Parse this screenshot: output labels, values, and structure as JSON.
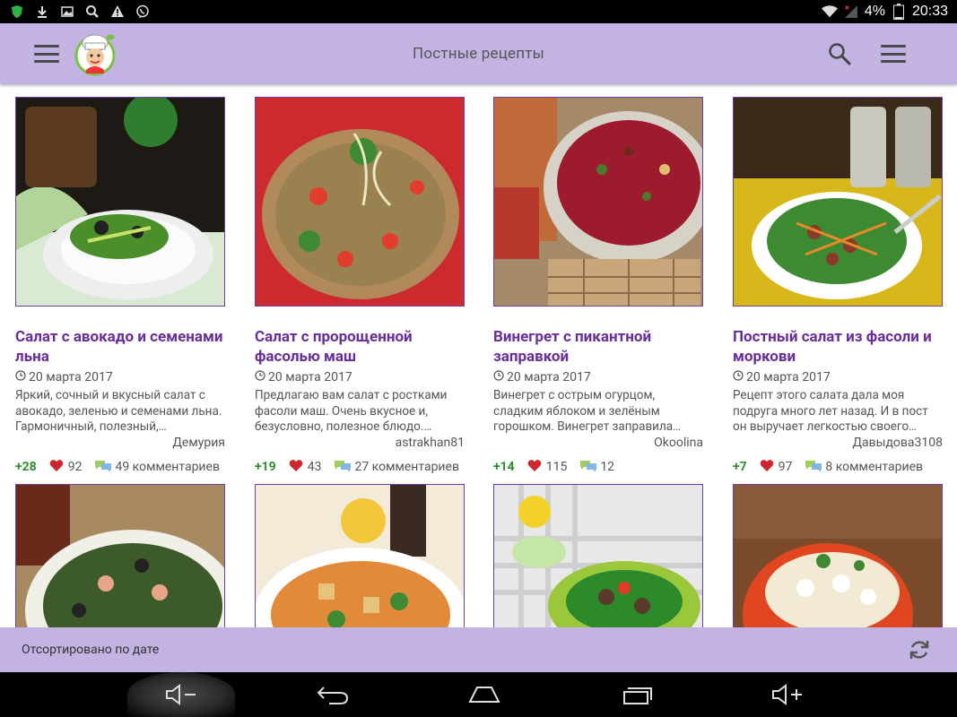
{
  "status_bar": {
    "battery": "4%",
    "time": "20:33",
    "icons": [
      "shield-icon",
      "download-icon",
      "image-icon",
      "search-icon",
      "warning-icon",
      "viber-icon",
      "wifi-icon",
      "signal-icon",
      "battery-icon"
    ]
  },
  "app_bar": {
    "title": "Постные рецепты",
    "icons": [
      "hamburger-icon",
      "chef-logo",
      "search-icon",
      "menu-icon"
    ],
    "colors": {
      "background": "#c3b3e3",
      "title": "#555555"
    }
  },
  "recipes": [
    {
      "title": "Салат с авокадо и семенами льна",
      "date": "20 марта 2017",
      "description": "Яркий, сочный и вкусный салат с авокадо, зеленью и семенами льна. Гармоничный, полезный,…",
      "author": "Демурия",
      "rating": "+28",
      "likes": "92",
      "comments": "49 комментариев"
    },
    {
      "title": "Салат с пророщенной фасолью маш",
      "date": "20 марта 2017",
      "description": "Предлагаю вам салат с ростками фасоли маш. Очень вкусное и, безусловно, полезное блюдо.…",
      "author": "astrakhan81",
      "rating": "+19",
      "likes": "43",
      "comments": "27 комментариев"
    },
    {
      "title": "Винегрет с пикантной заправкой",
      "date": "20 марта 2017",
      "description": "Винегрет с острым огурцом, сладким яблоком и зелёным горошком. Винегрет заправила…",
      "author": "Okoolina",
      "rating": "+14",
      "likes": "115",
      "comments": "12"
    },
    {
      "title": "Постный салат из фасоли и моркови",
      "date": "20 марта 2017",
      "description": "Рецепт этого салата дала моя подруга много лет назад. И в пост он выручает легкостью своего…",
      "author": "Давыдова3108",
      "rating": "+7",
      "likes": "97",
      "comments": "8 комментариев"
    }
  ],
  "colors": {
    "title_purple": "#6a2e9a",
    "rating_green": "#2e8b2e",
    "heart_red": "#d0262e",
    "accent_bar": "#c3b3e3"
  },
  "sort_bar": {
    "label": "Отсортировано по дате",
    "icon": "refresh-icon"
  },
  "nav_bar": {
    "icons": [
      "volume-down-icon",
      "back-icon",
      "home-icon",
      "recents-icon",
      "volume-up-icon"
    ]
  }
}
